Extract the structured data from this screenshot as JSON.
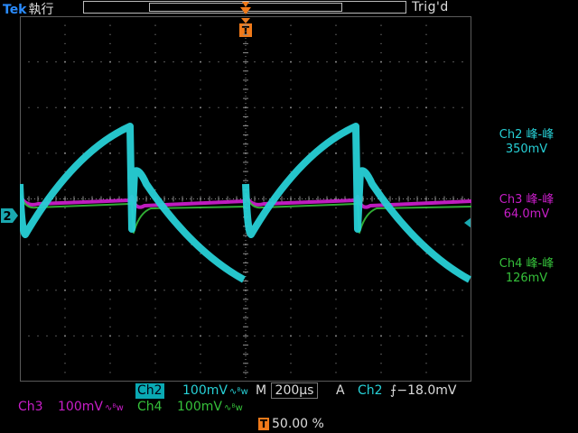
{
  "header": {
    "brand": "Tek",
    "mode": "執行",
    "trigger_state": "Trig'd"
  },
  "markers": {
    "trigger_marker": "T",
    "ch2_ground": "2"
  },
  "measurements": [
    {
      "label": "Ch2 峰-峰",
      "value": "350mV",
      "color": "#27d0d6"
    },
    {
      "label": "Ch3 峰-峰",
      "value": "64.0mV",
      "color": "#c81ec8"
    },
    {
      "label": "Ch4 峰-峰",
      "value": "126mV",
      "color": "#35c03a"
    }
  ],
  "bottom": {
    "ch2": {
      "name": "Ch2",
      "scale": "100mV",
      "coupling": "∿ᴮw"
    },
    "ch3": {
      "name": "Ch3",
      "scale": "100mV",
      "coupling": "∿ᴮw"
    },
    "ch4": {
      "name": "Ch4",
      "scale": "100mV",
      "coupling": "∿ᴮw"
    },
    "timebase": {
      "prefix": "M",
      "value": "200µs"
    },
    "trigger": {
      "prefix": "A",
      "source": "Ch2",
      "slope": "⨍",
      "level": "−18.0mV"
    },
    "trigger_position": "50.00 %"
  },
  "colors": {
    "ch2": "#27d0d6",
    "ch3": "#c81ec8",
    "ch4": "#35c03a",
    "grid": "#8a8a8a",
    "trigger": "#f07a1a"
  }
}
